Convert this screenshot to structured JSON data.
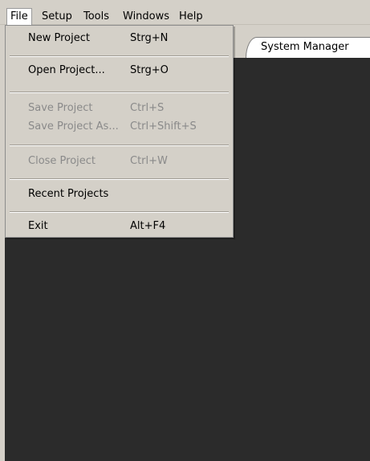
{
  "menubar": {
    "items": [
      {
        "label": "File"
      },
      {
        "label": "Setup"
      },
      {
        "label": "Tools"
      },
      {
        "label": "Windows"
      },
      {
        "label": "Help"
      }
    ]
  },
  "tabs": {
    "items": [
      {
        "label": "System Manager"
      }
    ]
  },
  "file_menu": {
    "items": [
      {
        "label": "New Project",
        "shortcut": "Strg+N",
        "enabled": true
      },
      {
        "label": "Open Project...",
        "shortcut": "Strg+O",
        "enabled": true
      },
      {
        "label": "Save Project",
        "shortcut": "Ctrl+S",
        "enabled": false
      },
      {
        "label": "Save Project As...",
        "shortcut": "Ctrl+Shift+S",
        "enabled": false
      },
      {
        "label": "Close Project",
        "shortcut": "Ctrl+W",
        "enabled": false
      },
      {
        "label": "Recent Projects",
        "shortcut": "",
        "enabled": true
      },
      {
        "label": "Exit",
        "shortcut": "Alt+F4",
        "enabled": true
      }
    ]
  },
  "colors": {
    "menu_background": "#d4d0c8",
    "workspace_dark": "#2b2b2b",
    "disabled_text": "#8a8a8a"
  }
}
